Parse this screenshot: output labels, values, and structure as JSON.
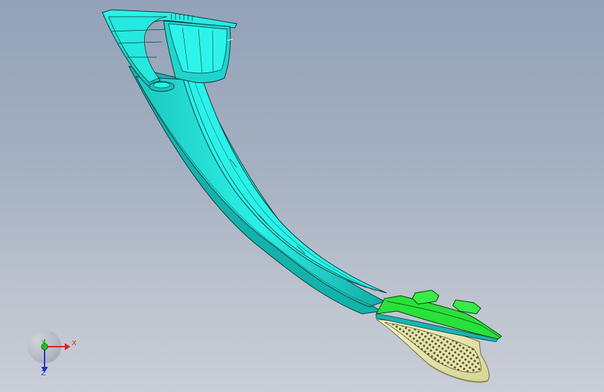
{
  "viewport": {
    "background_top": "#93a2b8",
    "background_bottom": "#c9ced7"
  },
  "model": {
    "body_color": "#22e0d8",
    "body_shadow_color": "#11b5ad",
    "edge_color": "#0c3a3a",
    "pad_color": "#28e03c",
    "grip_color": "#ecebb4"
  },
  "triad": {
    "x_label": "X",
    "y_label": "Y",
    "z_label": "Z",
    "x_color": "#e02020",
    "y_color": "#20c020",
    "z_color": "#2030d0"
  }
}
